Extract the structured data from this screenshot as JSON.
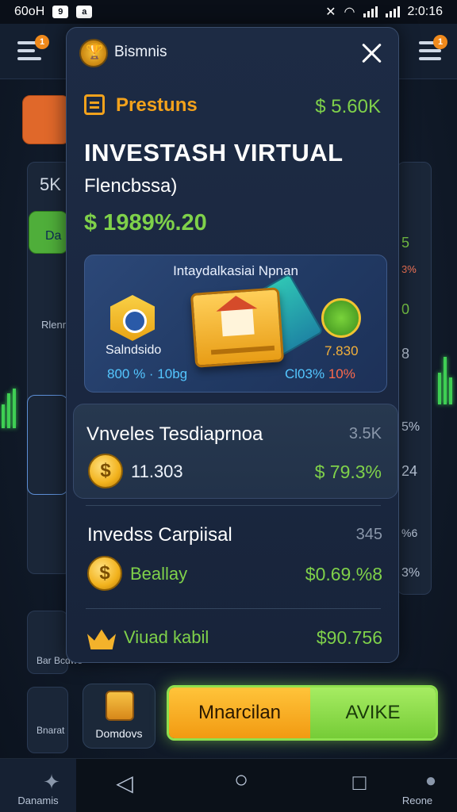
{
  "status_bar": {
    "left_text": "60oH",
    "box1": "9",
    "box2": "a",
    "time": "2:0:16"
  },
  "background": {
    "menu_badge_left": "1",
    "menu_badge_right": "1",
    "left_card_stat": "5K",
    "left_green_button": "Da",
    "left_labels": [
      "Rlenr",
      "Bar Bcdwe",
      "Bnarat"
    ],
    "right_card_stats": [
      "5",
      "3%",
      "0",
      "8",
      "5%",
      "24",
      "%6",
      "3%"
    ],
    "accent_green": "#7fd14a",
    "accent_orange": "#f3a21c"
  },
  "modal": {
    "header_title": "Bismnis",
    "premium_label": "Prestuns",
    "premium_value": "$ 5.60K",
    "main_title": "INVESTASH VIRTUAL",
    "sub_title": "Flencbssa)",
    "big_amount": "$ 1989%.20",
    "banner": {
      "title": "Intaydalkasiai Npnan",
      "left_label": "Salndsido",
      "left_stat": "800 % · 10bg",
      "right_value": "7.830",
      "right_stat_blue": "Cl03%",
      "right_stat_red": "10%"
    },
    "rows": [
      {
        "title": "Vnveles Tesdiaprnoa",
        "meta": "3.5K",
        "sub": "11.303",
        "value": "$ 79.3%"
      },
      {
        "title": "Invedss Carpiisal",
        "meta": "345",
        "sub": "Beallay",
        "value": "$0.69.%8"
      },
      {
        "title": "",
        "meta": "",
        "sub": "Viuad kabil",
        "value": "$90.756"
      }
    ]
  },
  "bottom_bar": {
    "diamonds_label": "Domdovs",
    "cta_left": "Mnarcilan",
    "cta_right": "AVIKE"
  },
  "nav": {
    "left_label": "Danamis",
    "right_label": "Reone"
  }
}
